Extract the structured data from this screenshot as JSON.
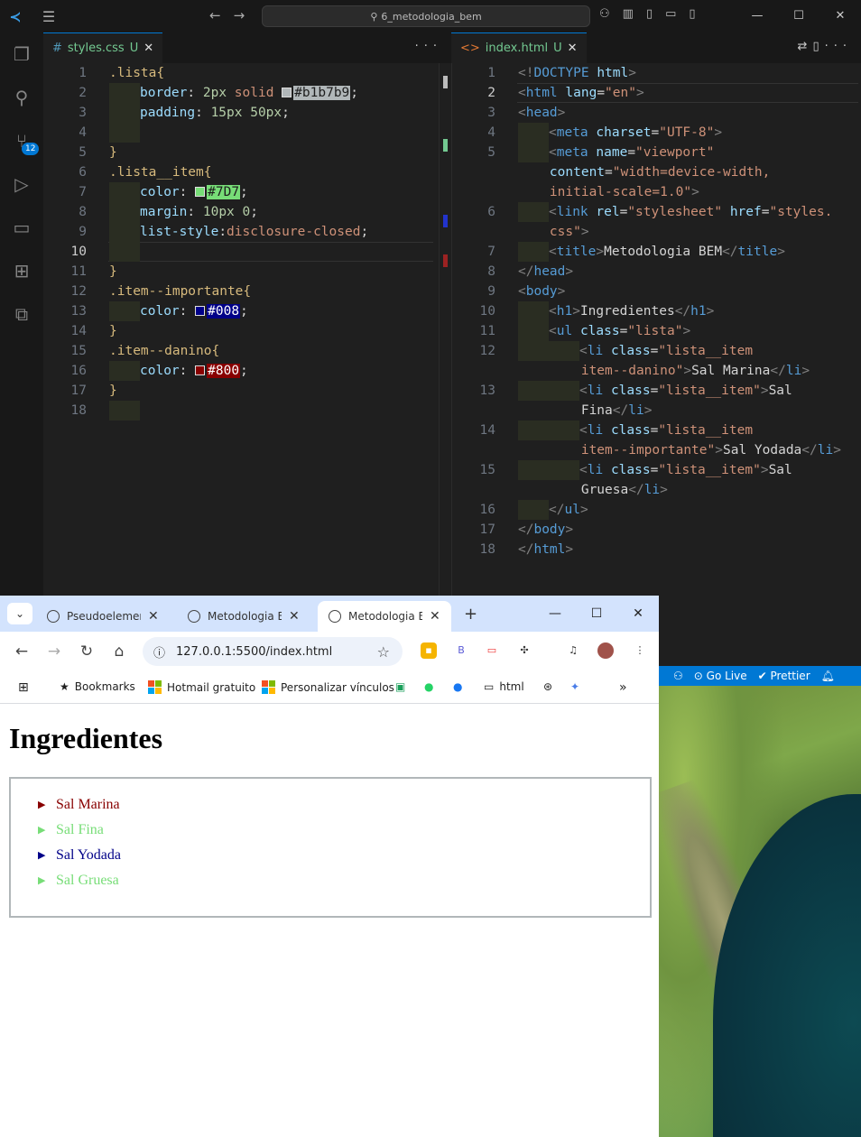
{
  "vscode": {
    "search_text": "6_metodologia_bem",
    "scm_badge": "12",
    "left_tab": {
      "icon": "#",
      "name": "styles.css",
      "status": "U"
    },
    "right_tab": {
      "icon": "<>",
      "name": "index.html",
      "status": "U"
    },
    "css_lines": [
      {
        "n": "1",
        "segs": [
          [
            "sel",
            ".lista{"
          ]
        ]
      },
      {
        "n": "2",
        "segs": [
          [
            "ind",
            ""
          ],
          [
            "prop",
            "border"
          ],
          [
            "txt",
            ": "
          ],
          [
            "num",
            "2px"
          ],
          [
            "val",
            " solid "
          ],
          [
            "sw",
            "#b1b7b9"
          ],
          [
            "hl",
            "#b1b7b9"
          ],
          [
            "txt",
            ";"
          ]
        ]
      },
      {
        "n": "3",
        "segs": [
          [
            "ind",
            ""
          ],
          [
            "prop",
            "padding"
          ],
          [
            "txt",
            ": "
          ],
          [
            "num",
            "15px 50px"
          ],
          [
            "txt",
            ";"
          ]
        ]
      },
      {
        "n": "4",
        "segs": [
          [
            "ind",
            ""
          ]
        ]
      },
      {
        "n": "5",
        "segs": [
          [
            "sel",
            "}"
          ]
        ]
      },
      {
        "n": "6",
        "segs": [
          [
            "sel",
            ".lista__item{"
          ]
        ]
      },
      {
        "n": "7",
        "segs": [
          [
            "ind",
            ""
          ],
          [
            "prop",
            "color"
          ],
          [
            "txt",
            ": "
          ],
          [
            "sw",
            "#7D7"
          ],
          [
            "hl",
            "#7D7"
          ],
          [
            "txt",
            ";"
          ]
        ]
      },
      {
        "n": "8",
        "segs": [
          [
            "ind",
            ""
          ],
          [
            "prop",
            "margin"
          ],
          [
            "txt",
            ": "
          ],
          [
            "num",
            "10px 0"
          ],
          [
            "txt",
            ";"
          ]
        ]
      },
      {
        "n": "9",
        "segs": [
          [
            "ind",
            ""
          ],
          [
            "prop",
            "list-style"
          ],
          [
            "txt",
            ":"
          ],
          [
            "val",
            "disclosure-closed"
          ],
          [
            "txt",
            ";"
          ]
        ]
      },
      {
        "n": "10",
        "segs": [
          [
            "ind",
            ""
          ]
        ]
      },
      {
        "n": "11",
        "segs": [
          [
            "sel",
            "}"
          ]
        ]
      },
      {
        "n": "12",
        "segs": [
          [
            "sel",
            ".item--importante{"
          ]
        ]
      },
      {
        "n": "13",
        "segs": [
          [
            "ind",
            ""
          ],
          [
            "prop",
            "color"
          ],
          [
            "txt",
            ": "
          ],
          [
            "sw",
            "#008"
          ],
          [
            "hl",
            "#008"
          ],
          [
            "txt",
            ";"
          ]
        ]
      },
      {
        "n": "14",
        "segs": [
          [
            "sel",
            "}"
          ]
        ]
      },
      {
        "n": "15",
        "segs": [
          [
            "sel",
            ".item--danino{"
          ]
        ]
      },
      {
        "n": "16",
        "segs": [
          [
            "ind",
            ""
          ],
          [
            "prop",
            "color"
          ],
          [
            "txt",
            ": "
          ],
          [
            "sw",
            "#800"
          ],
          [
            "hl",
            "#800"
          ],
          [
            "txt",
            ";"
          ]
        ]
      },
      {
        "n": "17",
        "segs": [
          [
            "sel",
            "}"
          ]
        ]
      },
      {
        "n": "18",
        "segs": [
          [
            "ind",
            ""
          ]
        ]
      }
    ],
    "html_lines": [
      {
        "n": "1",
        "segs": [
          [
            "punc",
            "<!"
          ],
          [
            "tag",
            "DOCTYPE"
          ],
          [
            "txt",
            " "
          ],
          [
            "attr",
            "html"
          ],
          [
            "punc",
            ">"
          ]
        ]
      },
      {
        "n": "2",
        "segs": [
          [
            "punc",
            "<"
          ],
          [
            "tag",
            "html"
          ],
          [
            "txt",
            " "
          ],
          [
            "attr",
            "lang"
          ],
          [
            "txt",
            "="
          ],
          [
            "str",
            "\"en\""
          ],
          [
            "punc",
            ">"
          ]
        ]
      },
      {
        "n": "3",
        "segs": [
          [
            "punc",
            "<"
          ],
          [
            "tag",
            "head"
          ],
          [
            "punc",
            ">"
          ]
        ]
      },
      {
        "n": "4",
        "segs": [
          [
            "ind",
            ""
          ],
          [
            "punc",
            "<"
          ],
          [
            "tag",
            "meta"
          ],
          [
            "txt",
            " "
          ],
          [
            "attr",
            "charset"
          ],
          [
            "txt",
            "="
          ],
          [
            "str",
            "\"UTF-8\""
          ],
          [
            "punc",
            ">"
          ]
        ]
      },
      {
        "n": "5",
        "segs": [
          [
            "ind",
            ""
          ],
          [
            "punc",
            "<"
          ],
          [
            "tag",
            "meta"
          ],
          [
            "txt",
            " "
          ],
          [
            "attr",
            "name"
          ],
          [
            "txt",
            "="
          ],
          [
            "str",
            "\"viewport\""
          ]
        ]
      },
      {
        "n": "",
        "segs": [
          [
            "sp",
            "    "
          ],
          [
            "attr",
            "content"
          ],
          [
            "txt",
            "="
          ],
          [
            "str",
            "\"width=device-width,"
          ]
        ]
      },
      {
        "n": "",
        "segs": [
          [
            "sp",
            "    "
          ],
          [
            "str",
            "initial-scale=1.0\""
          ],
          [
            "punc",
            ">"
          ]
        ]
      },
      {
        "n": "6",
        "segs": [
          [
            "ind",
            ""
          ],
          [
            "punc",
            "<"
          ],
          [
            "tag",
            "link"
          ],
          [
            "txt",
            " "
          ],
          [
            "attr",
            "rel"
          ],
          [
            "txt",
            "="
          ],
          [
            "str",
            "\"stylesheet\""
          ],
          [
            "txt",
            " "
          ],
          [
            "attr",
            "href"
          ],
          [
            "txt",
            "="
          ],
          [
            "str",
            "\"styles."
          ]
        ]
      },
      {
        "n": "",
        "segs": [
          [
            "sp",
            "    "
          ],
          [
            "str",
            "css\""
          ],
          [
            "punc",
            ">"
          ]
        ]
      },
      {
        "n": "7",
        "segs": [
          [
            "ind",
            ""
          ],
          [
            "punc",
            "<"
          ],
          [
            "tag",
            "title"
          ],
          [
            "punc",
            ">"
          ],
          [
            "txt",
            "Metodologia BEM"
          ],
          [
            "punc",
            "</"
          ],
          [
            "tag",
            "title"
          ],
          [
            "punc",
            ">"
          ]
        ]
      },
      {
        "n": "8",
        "segs": [
          [
            "punc",
            "</"
          ],
          [
            "tag",
            "head"
          ],
          [
            "punc",
            ">"
          ]
        ]
      },
      {
        "n": "9",
        "segs": [
          [
            "punc",
            "<"
          ],
          [
            "tag",
            "body"
          ],
          [
            "punc",
            ">"
          ]
        ]
      },
      {
        "n": "10",
        "segs": [
          [
            "ind",
            ""
          ],
          [
            "punc",
            "<"
          ],
          [
            "tag",
            "h1"
          ],
          [
            "punc",
            ">"
          ],
          [
            "txt",
            "Ingredientes"
          ],
          [
            "punc",
            "</"
          ],
          [
            "tag",
            "h1"
          ],
          [
            "punc",
            ">"
          ]
        ]
      },
      {
        "n": "11",
        "segs": [
          [
            "ind",
            ""
          ],
          [
            "punc",
            "<"
          ],
          [
            "tag",
            "ul"
          ],
          [
            "txt",
            " "
          ],
          [
            "attr",
            "class"
          ],
          [
            "txt",
            "="
          ],
          [
            "str",
            "\"lista\""
          ],
          [
            "punc",
            ">"
          ]
        ]
      },
      {
        "n": "12",
        "segs": [
          [
            "ind",
            ""
          ],
          [
            "ind",
            ""
          ],
          [
            "punc",
            "<"
          ],
          [
            "tag",
            "li"
          ],
          [
            "txt",
            " "
          ],
          [
            "attr",
            "class"
          ],
          [
            "txt",
            "="
          ],
          [
            "str",
            "\"lista__item"
          ]
        ]
      },
      {
        "n": "",
        "segs": [
          [
            "sp",
            "        "
          ],
          [
            "str",
            "item--danino\""
          ],
          [
            "punc",
            ">"
          ],
          [
            "txt",
            "Sal Marina"
          ],
          [
            "punc",
            "</"
          ],
          [
            "tag",
            "li"
          ],
          [
            "punc",
            ">"
          ]
        ]
      },
      {
        "n": "13",
        "segs": [
          [
            "ind",
            ""
          ],
          [
            "ind",
            ""
          ],
          [
            "punc",
            "<"
          ],
          [
            "tag",
            "li"
          ],
          [
            "txt",
            " "
          ],
          [
            "attr",
            "class"
          ],
          [
            "txt",
            "="
          ],
          [
            "str",
            "\"lista__item\""
          ],
          [
            "punc",
            ">"
          ],
          [
            "txt",
            "Sal"
          ]
        ]
      },
      {
        "n": "",
        "segs": [
          [
            "sp",
            "        "
          ],
          [
            "txt",
            "Fina"
          ],
          [
            "punc",
            "</"
          ],
          [
            "tag",
            "li"
          ],
          [
            "punc",
            ">"
          ]
        ]
      },
      {
        "n": "14",
        "segs": [
          [
            "ind",
            ""
          ],
          [
            "ind",
            ""
          ],
          [
            "punc",
            "<"
          ],
          [
            "tag",
            "li"
          ],
          [
            "txt",
            " "
          ],
          [
            "attr",
            "class"
          ],
          [
            "txt",
            "="
          ],
          [
            "str",
            "\"lista__item"
          ]
        ]
      },
      {
        "n": "",
        "segs": [
          [
            "sp",
            "        "
          ],
          [
            "str",
            "item--importante\""
          ],
          [
            "punc",
            ">"
          ],
          [
            "txt",
            "Sal Yodada"
          ],
          [
            "punc",
            "</"
          ],
          [
            "tag",
            "li"
          ],
          [
            "punc",
            ">"
          ]
        ]
      },
      {
        "n": "15",
        "segs": [
          [
            "ind",
            ""
          ],
          [
            "ind",
            ""
          ],
          [
            "punc",
            "<"
          ],
          [
            "tag",
            "li"
          ],
          [
            "txt",
            " "
          ],
          [
            "attr",
            "class"
          ],
          [
            "txt",
            "="
          ],
          [
            "str",
            "\"lista__item\""
          ],
          [
            "punc",
            ">"
          ],
          [
            "txt",
            "Sal"
          ]
        ]
      },
      {
        "n": "",
        "segs": [
          [
            "sp",
            "        "
          ],
          [
            "txt",
            "Gruesa"
          ],
          [
            "punc",
            "</"
          ],
          [
            "tag",
            "li"
          ],
          [
            "punc",
            ">"
          ]
        ]
      },
      {
        "n": "16",
        "segs": [
          [
            "ind",
            ""
          ],
          [
            "punc",
            "</"
          ],
          [
            "tag",
            "ul"
          ],
          [
            "punc",
            ">"
          ]
        ]
      },
      {
        "n": "17",
        "segs": [
          [
            "punc",
            "</"
          ],
          [
            "tag",
            "body"
          ],
          [
            "punc",
            ">"
          ]
        ]
      },
      {
        "n": "18",
        "segs": [
          [
            "punc",
            "</"
          ],
          [
            "tag",
            "html"
          ],
          [
            "punc",
            ">"
          ]
        ]
      }
    ],
    "status_items": [
      "Go Live",
      "Prettier"
    ]
  },
  "chrome": {
    "tabs": [
      {
        "title": "Pseudoelementos"
      },
      {
        "title": "Metodologia BEM"
      },
      {
        "title": "Metodologia BEM"
      }
    ],
    "url": "127.0.0.1:5500/index.html",
    "bookmarks": [
      "Bookmarks",
      "Hotmail gratuito",
      "Personalizar vínculos",
      "html"
    ]
  },
  "page": {
    "heading": "Ingredientes",
    "items": [
      {
        "text": "Sal Marina",
        "color": "#880000"
      },
      {
        "text": "Sal Fina",
        "color": "#77dd77"
      },
      {
        "text": "Sal Yodada",
        "color": "#000088"
      },
      {
        "text": "Sal Gruesa",
        "color": "#77dd77"
      }
    ]
  },
  "colors": {
    "accent": "#0078d4",
    "border": "#b1b7b9"
  }
}
